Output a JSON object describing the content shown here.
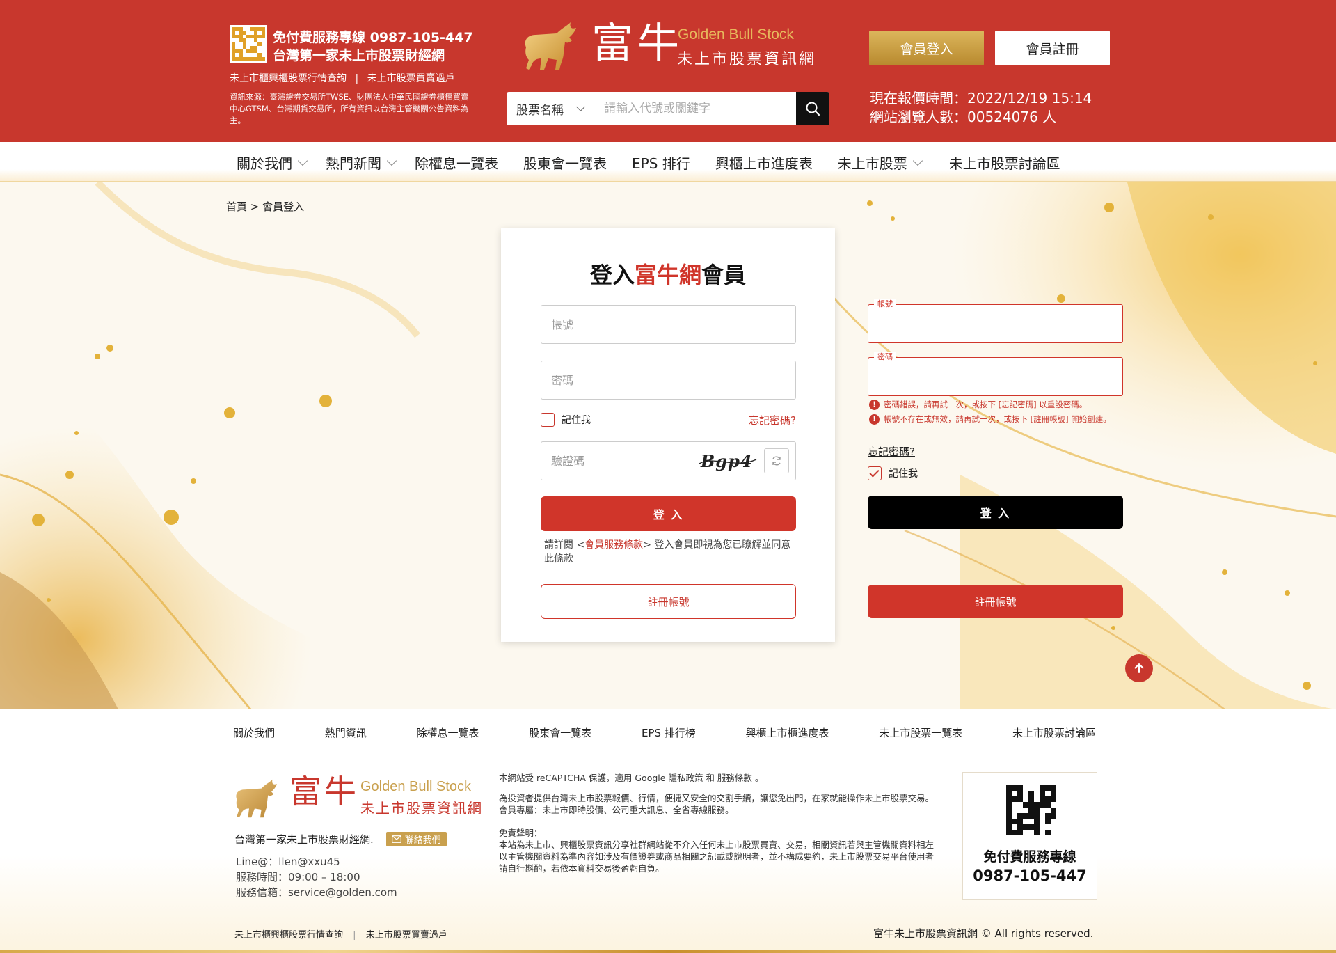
{
  "header": {
    "hotline_label": "免付費服務專線 0987-105-447",
    "slogan": "台灣第一家未上市股票財經網",
    "link_quotes": "未上市櫃興櫃股票行情查詢",
    "link_sep": "|",
    "link_transfer": "未上市股票買賣過戶",
    "source_note": "資訊來源：臺灣證券交易所TWSE、財團法人中華民國證券櫃檯買賣中心GTSM、台灣期貨交易所，所有資訊以台灣主管機關公告資料為主。",
    "logo_cn": "富牛",
    "logo_en": "Golden Bull Stock",
    "logo_sub": "未上市股票資訊網",
    "search_type": "股票名稱",
    "search_placeholder": "請輸入代號或關鍵字",
    "login_btn": "會員登入",
    "register_btn": "會員註冊",
    "quote_time": "現在報價時間：2022/12/19 15:14",
    "visitors": "網站瀏覽人數：00524076 人"
  },
  "nav": [
    {
      "label": "關於我們",
      "dropdown": true
    },
    {
      "label": "熱門新聞",
      "dropdown": true
    },
    {
      "label": "除權息一覽表",
      "dropdown": false
    },
    {
      "label": "股東會一覽表",
      "dropdown": false
    },
    {
      "label": "EPS 排行",
      "dropdown": false
    },
    {
      "label": "興櫃上市進度表",
      "dropdown": false
    },
    {
      "label": "未上市股票",
      "dropdown": true
    },
    {
      "label": "未上市股票討論區",
      "dropdown": false
    }
  ],
  "breadcrumb": "首頁 > 會員登入",
  "login": {
    "title_pre": "登入",
    "title_hl": "富牛網",
    "title_post": "會員",
    "account_placeholder": "帳號",
    "password_placeholder": "密碼",
    "remember": "記住我",
    "forgot": "忘記密碼?",
    "captcha_placeholder": "驗證碼",
    "captcha_text": "Bgp4",
    "submit": "登 入",
    "terms_pre": "請詳閱 <",
    "terms_link": "會員服務條款",
    "terms_post": "> 登入會員即視為您已瞭解並同意此條款",
    "register": "註冊帳號"
  },
  "error_state": {
    "account_label": "帳號",
    "password_label": "密碼",
    "err_password": "密碼錯誤，請再試一次，或按下 [忘記密碼] 以重設密碼。",
    "err_account": "帳號不存在或無效，請再試一次，或按下 [註冊帳號] 開始創建。",
    "forgot": "忘記密碼?",
    "remember": "記住我",
    "submit": "登 入",
    "register": "註冊帳號"
  },
  "footer": {
    "nav": [
      "關於我們",
      "熱門資訊",
      "除權息一覽表",
      "股東會一覽表",
      "EPS 排行榜",
      "興櫃上市櫃進度表",
      "未上市股票一覽表",
      "未上市股票討論區"
    ],
    "logo_cn": "富牛",
    "logo_en": "Golden Bull Stock",
    "logo_sub": "未上市股票資訊網",
    "tagline": "台灣第一家未上市股票財經網.",
    "contact_btn": "聯絡我們",
    "line": "Line@：llen@xxu45",
    "hours": "服務時間：09:00 – 18:00",
    "email": "服務信箱：service@golden.com",
    "recaptcha_pre": "本網站受 reCAPTCHA 保護，適用 Google ",
    "privacy": "隱私政策",
    "and": " 和 ",
    "tos": "服務條款",
    "recaptcha_post": " 。",
    "desc": "為投資者提供台灣未上市股票報價、行情，便捷又安全的交割手續，讓您免出門，在家就能操作未上市股票交易。",
    "member_zone": "會員專屬：未上市即時股價、公司重大訊息、全省專線服務。",
    "disclaimer_title": "免責聲明：",
    "disclaimer": "本站為未上市、興櫃股票資訊分享社群網站從不介入任何未上市股票買賣、交易，相關資訊若與主管機關資料相左以主管機關資料為準內容如涉及有價證券或商品相關之記載或說明者，並不構成要約，未上市股票交易平台使用者請自行斟酌，若依本資料交易後盈虧自負。",
    "qr_label": "免付費服務專線",
    "qr_phone": "0987-105-447",
    "bottom_quotes": "未上市櫃興櫃股票行情查詢",
    "bottom_sep": "|",
    "bottom_transfer": "未上市股票買賣過戶",
    "copyright": "富牛未上市股票資訊網 © All rights reserved."
  },
  "colors": {
    "brand_red": "#c8372d",
    "gold": "#c9a04e",
    "black_button": "#000000"
  }
}
